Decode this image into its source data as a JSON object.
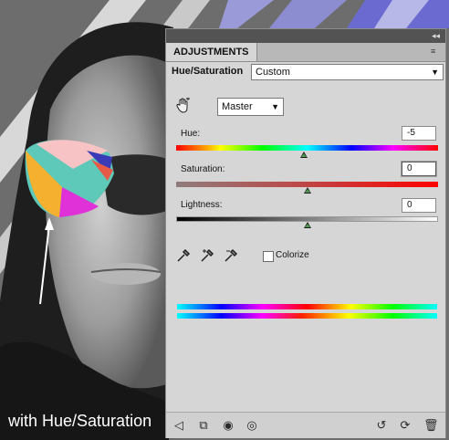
{
  "caption": "with Hue/Saturation",
  "panel": {
    "collapse_glyph": "◂◂",
    "tab_label": "ADJUSTMENTS",
    "menu_glyph": "≡",
    "title": "Hue/Saturation",
    "preset_value": "Custom",
    "channel_value": "Master",
    "hand_tool_icon": "on-image-adjust-icon",
    "hue": {
      "label": "Hue:",
      "value": "-5",
      "level": -5,
      "min": -180,
      "max": 180
    },
    "saturation": {
      "label": "Saturation:",
      "value": "0",
      "level": 0,
      "min": -100,
      "max": 100
    },
    "lightness": {
      "label": "Lightness:",
      "value": "0",
      "level": 0,
      "min": -100,
      "max": 100
    },
    "colorize_label": "Colorize",
    "colorize_checked": false,
    "bottom_icons": [
      "return-arrow-icon",
      "clip-to-layer-icon",
      "view-previous-icon",
      "visibility-eye-icon",
      "reset-icon",
      "refresh-icon",
      "trash-icon"
    ]
  },
  "colors": {
    "panel_bg": "#d6d6d6",
    "accent_green": "#4f9a4f"
  }
}
